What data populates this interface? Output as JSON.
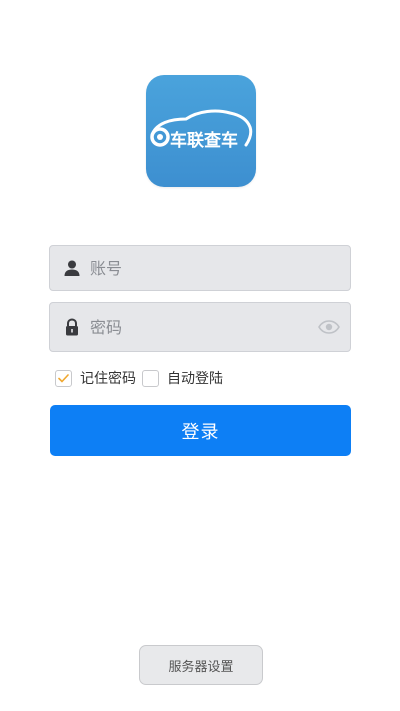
{
  "app": {
    "logo_text": "车联查车",
    "logo_color": "#3d8fd0"
  },
  "login_form": {
    "username_placeholder": "账号",
    "username_value": "",
    "username_icon": "user-icon",
    "password_placeholder": "密码",
    "password_value": "",
    "password_icon": "lock-icon",
    "password_toggle_icon": "eye-icon",
    "remember_password": {
      "label": "记住密码",
      "checked": true
    },
    "auto_login": {
      "label": "自动登陆",
      "checked": false
    },
    "login_label": "登录",
    "login_color": "#0d7ff5"
  },
  "footer": {
    "server_settings_label": "服务器设置"
  }
}
